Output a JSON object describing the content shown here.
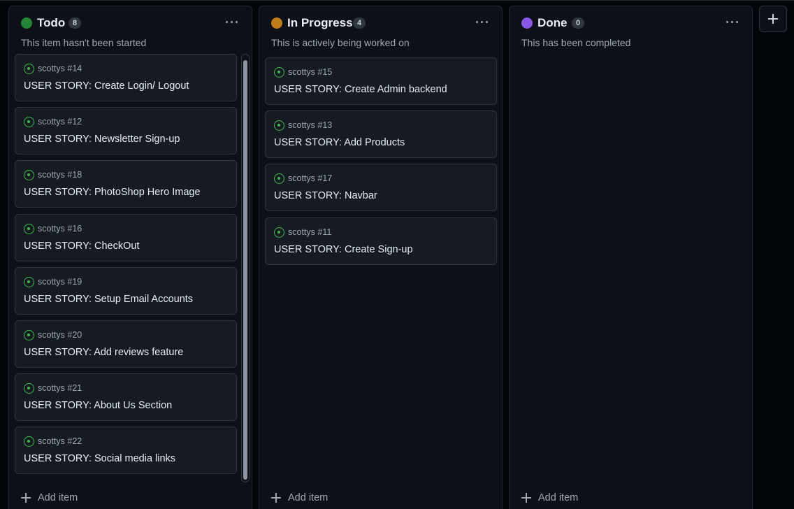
{
  "columns": [
    {
      "title": "Todo",
      "count": "8",
      "dot_color": "#238636",
      "description": "This item hasn't been started",
      "add_item_label": "Add item",
      "cards": [
        {
          "ref": "scottys #14",
          "title": "USER STORY: Create Login/ Logout"
        },
        {
          "ref": "scottys #12",
          "title": "USER STORY: Newsletter Sign-up"
        },
        {
          "ref": "scottys #18",
          "title": "USER STORY: PhotoShop Hero Image"
        },
        {
          "ref": "scottys #16",
          "title": "USER STORY: CheckOut"
        },
        {
          "ref": "scottys #19",
          "title": "USER STORY: Setup Email Accounts"
        },
        {
          "ref": "scottys #20",
          "title": "USER STORY: Add reviews feature"
        },
        {
          "ref": "scottys #21",
          "title": "USER STORY: About Us Section"
        },
        {
          "ref": "scottys #22",
          "title": "USER STORY: Social media links"
        }
      ]
    },
    {
      "title": "In Progress",
      "count": "4",
      "dot_color": "#bf7c1a",
      "description": "This is actively being worked on",
      "add_item_label": "Add item",
      "cards": [
        {
          "ref": "scottys #15",
          "title": "USER STORY: Create Admin backend"
        },
        {
          "ref": "scottys #13",
          "title": "USER STORY: Add Products"
        },
        {
          "ref": "scottys #17",
          "title": "USER STORY: Navbar"
        },
        {
          "ref": "scottys #11",
          "title": "USER STORY: Create Sign-up"
        }
      ]
    },
    {
      "title": "Done",
      "count": "0",
      "dot_color": "#8957e5",
      "description": "This has been completed",
      "add_item_label": "Add item",
      "cards": []
    }
  ],
  "icons": {
    "issue": "issue-open-icon",
    "menu": "kebab-menu-icon",
    "add": "plus-icon"
  },
  "colors": {
    "issue_open": "#3fb950",
    "background": "#010409",
    "column_bg": "#0d1117",
    "card_bg": "#161b22"
  }
}
